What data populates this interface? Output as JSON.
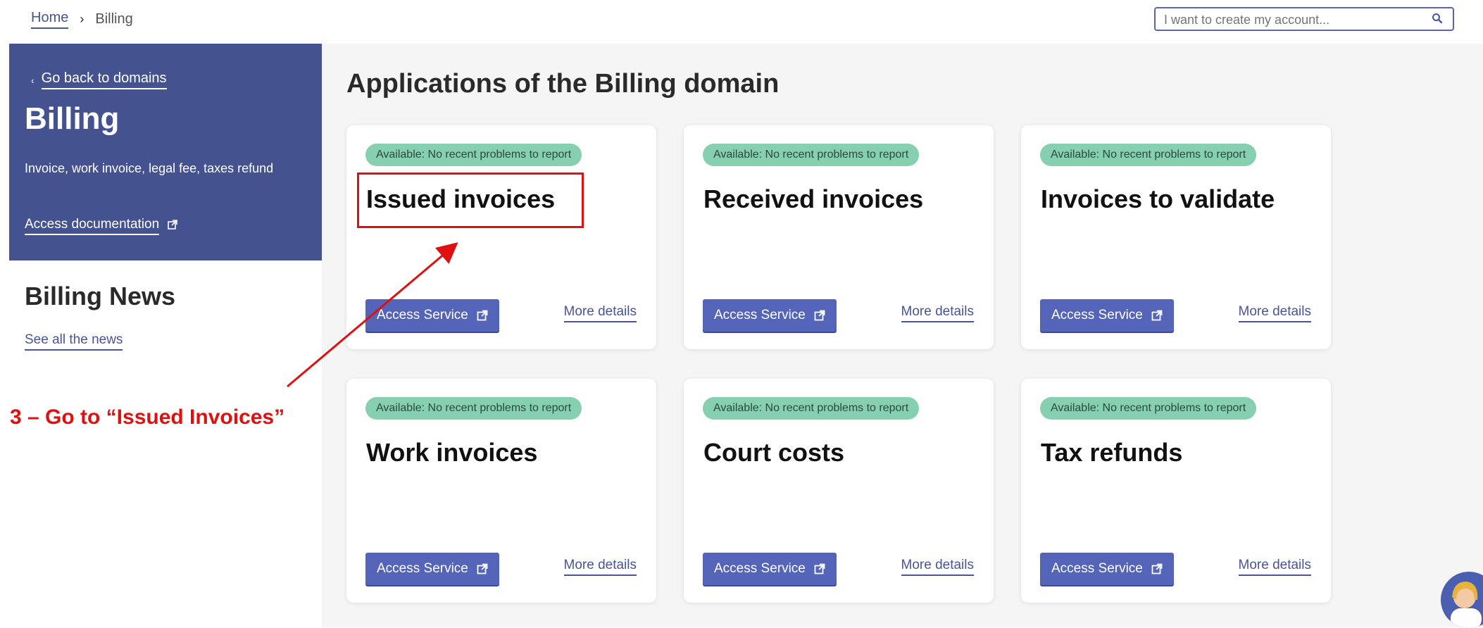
{
  "breadcrumb": {
    "home": "Home",
    "separator": "›",
    "current": "Billing"
  },
  "search": {
    "placeholder": "I want to create my account..."
  },
  "sidebar": {
    "back_label": "Go back to domains",
    "title": "Billing",
    "description": "Invoice, work invoice, legal fee, taxes refund",
    "doc_label": "Access documentation",
    "news_title": "Billing News",
    "news_link": "See all the news",
    "bg_color": "#455290"
  },
  "annotation": {
    "text": "3 – Go to “Issued Invoices”",
    "color": "#e01010"
  },
  "main": {
    "title": "Applications of the Billing domain",
    "cards": [
      {
        "status": "Available: No recent problems to report",
        "title": "Issued invoices",
        "button": "Access Service",
        "details": "More details"
      },
      {
        "status": "Available: No recent problems to report",
        "title": "Received invoices",
        "button": "Access Service",
        "details": "More details"
      },
      {
        "status": "Available: No recent problems to report",
        "title": "Invoices to validate",
        "button": "Access Service",
        "details": "More details"
      },
      {
        "status": "Available: No recent problems to report",
        "title": "Work invoices",
        "button": "Access Service",
        "details": "More details"
      },
      {
        "status": "Available: No recent problems to report",
        "title": "Court costs",
        "button": "Access Service",
        "details": "More details"
      },
      {
        "status": "Available: No recent problems to report",
        "title": "Tax refunds",
        "button": "Access Service",
        "details": "More details"
      }
    ]
  },
  "colors": {
    "accent": "#5464b8",
    "status_badge": "#86cfb0",
    "link": "#4a5494"
  },
  "icons": {
    "search": "search-icon",
    "external": "external-link-icon",
    "back": "chevron-left-icon",
    "avatar": "assistant-avatar"
  }
}
